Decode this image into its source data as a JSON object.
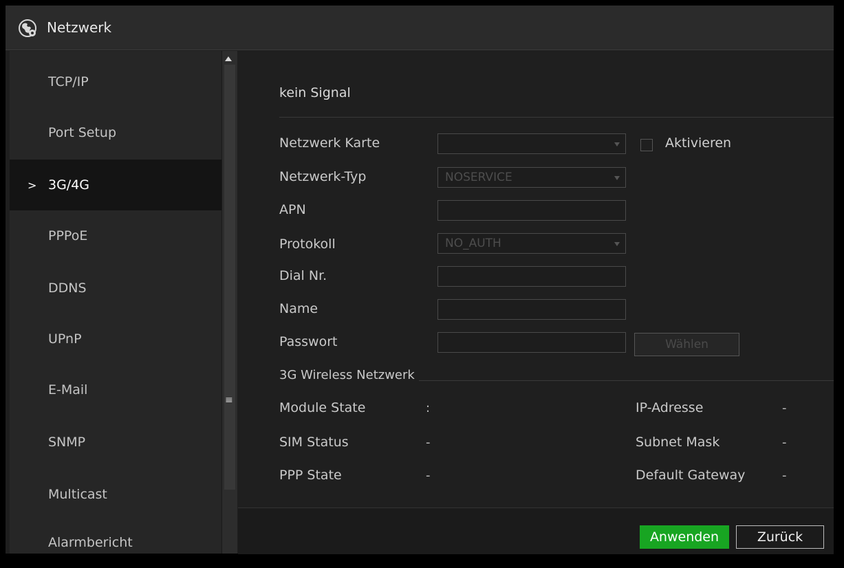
{
  "window": {
    "title": "Netzwerk",
    "title_icon": "network-globe-icon"
  },
  "sidebar": {
    "items": [
      {
        "label": "TCP/IP",
        "active": false
      },
      {
        "label": "Port Setup",
        "active": false
      },
      {
        "label": "3G/4G",
        "active": true
      },
      {
        "label": "PPPoE",
        "active": false
      },
      {
        "label": "DDNS",
        "active": false
      },
      {
        "label": "UPnP",
        "active": false
      },
      {
        "label": "E-Mail",
        "active": false
      },
      {
        "label": "SNMP",
        "active": false
      },
      {
        "label": "Multicast",
        "active": false
      },
      {
        "label": "Alarmbericht",
        "active": false
      }
    ],
    "active_marker": ">"
  },
  "main": {
    "status": "kein Signal",
    "fields": {
      "network_card": {
        "label": "Netzwerk Karte",
        "value": ""
      },
      "activate": {
        "label": "Aktivieren",
        "checked": false
      },
      "network_type": {
        "label": "Netzwerk-Typ",
        "value": "NOSERVICE"
      },
      "apn": {
        "label": "APN",
        "value": ""
      },
      "protocol": {
        "label": "Protokoll",
        "value": "NO_AUTH"
      },
      "dial_nr": {
        "label": "Dial Nr.",
        "value": ""
      },
      "name": {
        "label": "Name",
        "value": ""
      },
      "password": {
        "label": "Passwort",
        "value": ""
      },
      "choose_button": "Wählen"
    },
    "section_title": "3G Wireless Netzwerk",
    "info": {
      "module_state": {
        "label": "Module State",
        "value": ":"
      },
      "sim_status": {
        "label": "SIM Status",
        "value": "-"
      },
      "ppp_state": {
        "label": "PPP State",
        "value": "-"
      },
      "ip_address": {
        "label": "IP-Adresse",
        "value": "-"
      },
      "subnet_mask": {
        "label": "Subnet Mask",
        "value": "-"
      },
      "default_gateway": {
        "label": "Default Gateway",
        "value": "-"
      }
    }
  },
  "footer": {
    "apply_label": "Anwenden",
    "back_label": "Zurück"
  },
  "colors": {
    "accent_green": "#18a522",
    "background": "#1f1f1f",
    "sidebar_active": "#141414"
  }
}
